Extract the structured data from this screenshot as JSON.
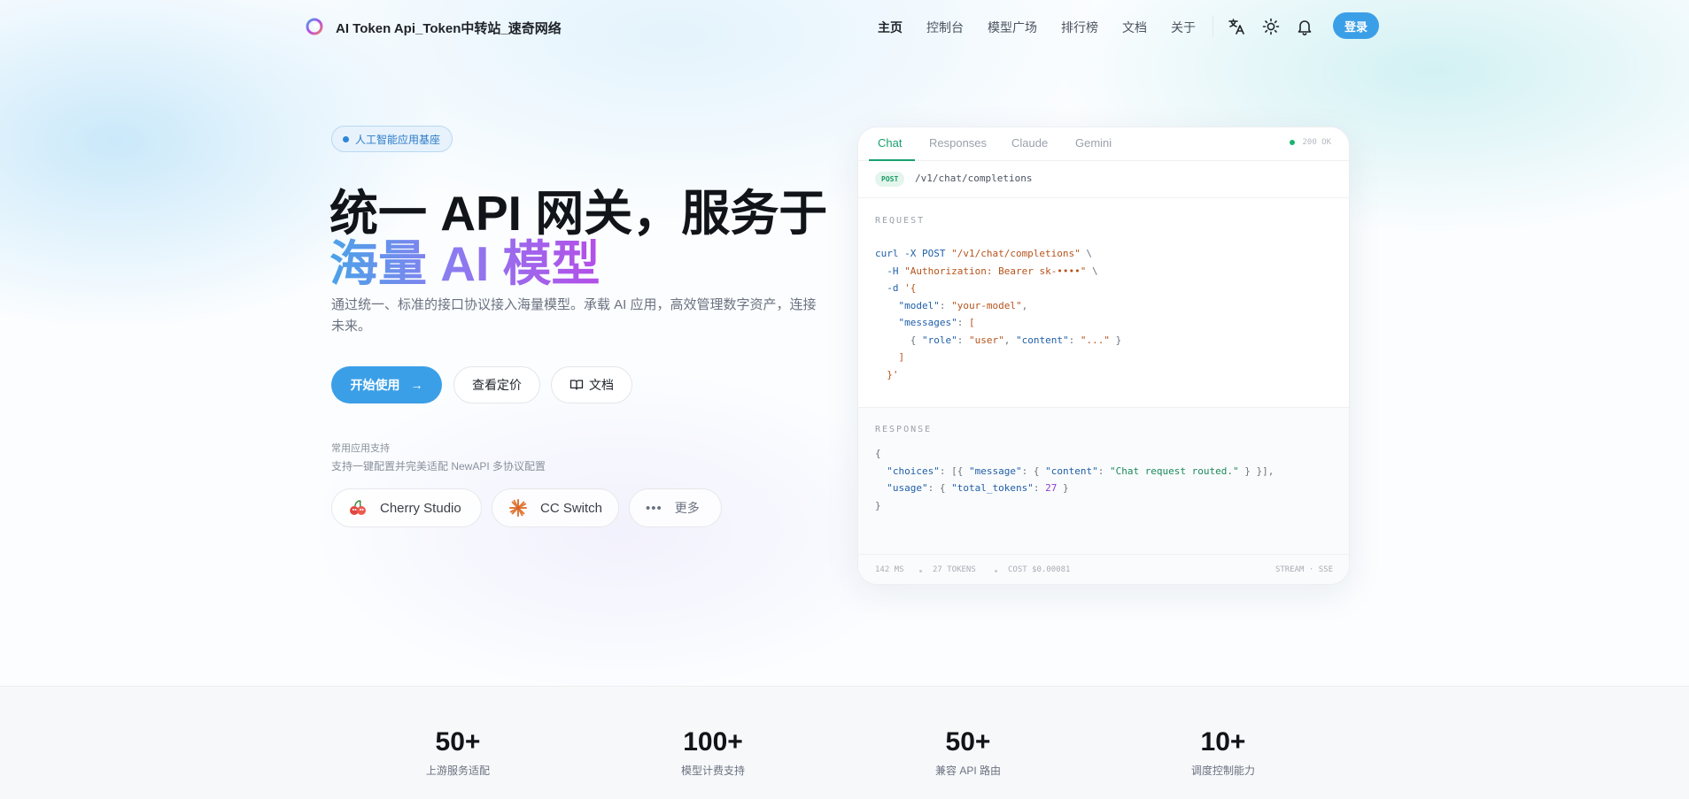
{
  "header": {
    "site_title": "AI Token Api_Token中转站_速奇网络",
    "nav": [
      "主页",
      "控制台",
      "模型广场",
      "排行榜",
      "文档",
      "关于"
    ],
    "login_label": "登录",
    "icons": [
      "translate-icon",
      "sun-icon",
      "bell-icon"
    ]
  },
  "hero": {
    "badge": "人工智能应用基座",
    "title_line1": "统一 API 网关，服务于",
    "title_line2": "海量 AI 模型",
    "description": "通过统一、标准的接口协议接入海量模型。承载 AI 应用，高效管理数字资产，连接未来。",
    "buttons": {
      "primary": "开始使用",
      "pricing": "查看定价",
      "docs": "文档"
    },
    "apps_title": "常用应用支持",
    "apps_subtitle": "支持一键配置并完美适配 NewAPI 多协议配置",
    "apps": [
      "Cherry Studio",
      "CC Switch",
      "更多"
    ]
  },
  "code_card": {
    "tabs": [
      "Chat",
      "Responses",
      "Claude",
      "Gemini"
    ],
    "active_tab": "Chat",
    "status": "200 OK",
    "method": "POST",
    "endpoint": "/v1/chat/completions",
    "request_label": "REQUEST",
    "response_label": "RESPONSE",
    "request_lines": [
      "curl -X POST \"/v1/chat/completions\" \\",
      "  -H \"Authorization: Bearer sk-••••\" \\",
      "  -d '{",
      "    \"model\": \"your-model\",",
      "    \"messages\": [",
      "      { \"role\": \"user\", \"content\": \"...\" }",
      "    ]",
      "  }'"
    ],
    "response_lines": [
      "{",
      "  \"choices\": [{ \"message\": { \"content\": \"Chat request routed.\" } }],",
      "  \"usage\": { \"total_tokens\": 27 }",
      "}"
    ],
    "footer": {
      "latency": "142 MS",
      "tokens": "27 TOKENS",
      "cost": "COST $0.00081",
      "mode": "STREAM · SSE"
    },
    "colors": {
      "accent": "#1aa06d"
    }
  },
  "stats": [
    {
      "value": "50+",
      "label": "上游服务适配"
    },
    {
      "value": "100+",
      "label": "模型计费支持"
    },
    {
      "value": "50+",
      "label": "兼容 API 路由"
    },
    {
      "value": "10+",
      "label": "调度控制能力"
    }
  ],
  "colors": {
    "primary": "#3b9fe8"
  }
}
